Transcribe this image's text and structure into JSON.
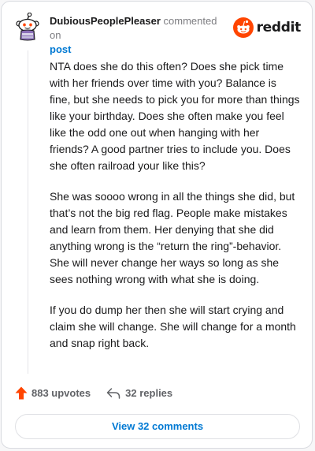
{
  "header": {
    "username": "DubiousPeoplePleaser",
    "commented_text": "commented on",
    "post_link": "post",
    "logo_text": "reddit"
  },
  "comment": {
    "paragraphs": [
      "NTA does she do this often? Does she pick time with her friends over time with you? Balance is fine, but she needs to pick you for more than things like your birthday. Does she often make you feel like the odd one out when hanging with her friends? A good partner tries to include you. Does she often railroad your like this?",
      "She was soooo wrong in all the things she did, but that’s not the big red flag. People make mistakes and learn from them. Her denying that she did anything wrong is the “return the ring”-behavior. She will never change her ways so long as she sees nothing wrong with what she is doing.",
      "If you do dump her then she will start crying and claim she will change. She will change for a month and snap right back."
    ]
  },
  "actions": {
    "upvotes": "883 upvotes",
    "replies": "32 replies",
    "view_comments": "View 32 comments"
  },
  "icons": {
    "avatar": "snoo-avatar-icon",
    "logo": "reddit-logo-icon",
    "upvote": "upvote-arrow-icon",
    "reply": "reply-arrow-icon"
  },
  "colors": {
    "accent_orange": "#ff4500",
    "link_blue": "#0079d3",
    "text": "#1a1a1b",
    "muted": "#7c7c80"
  }
}
